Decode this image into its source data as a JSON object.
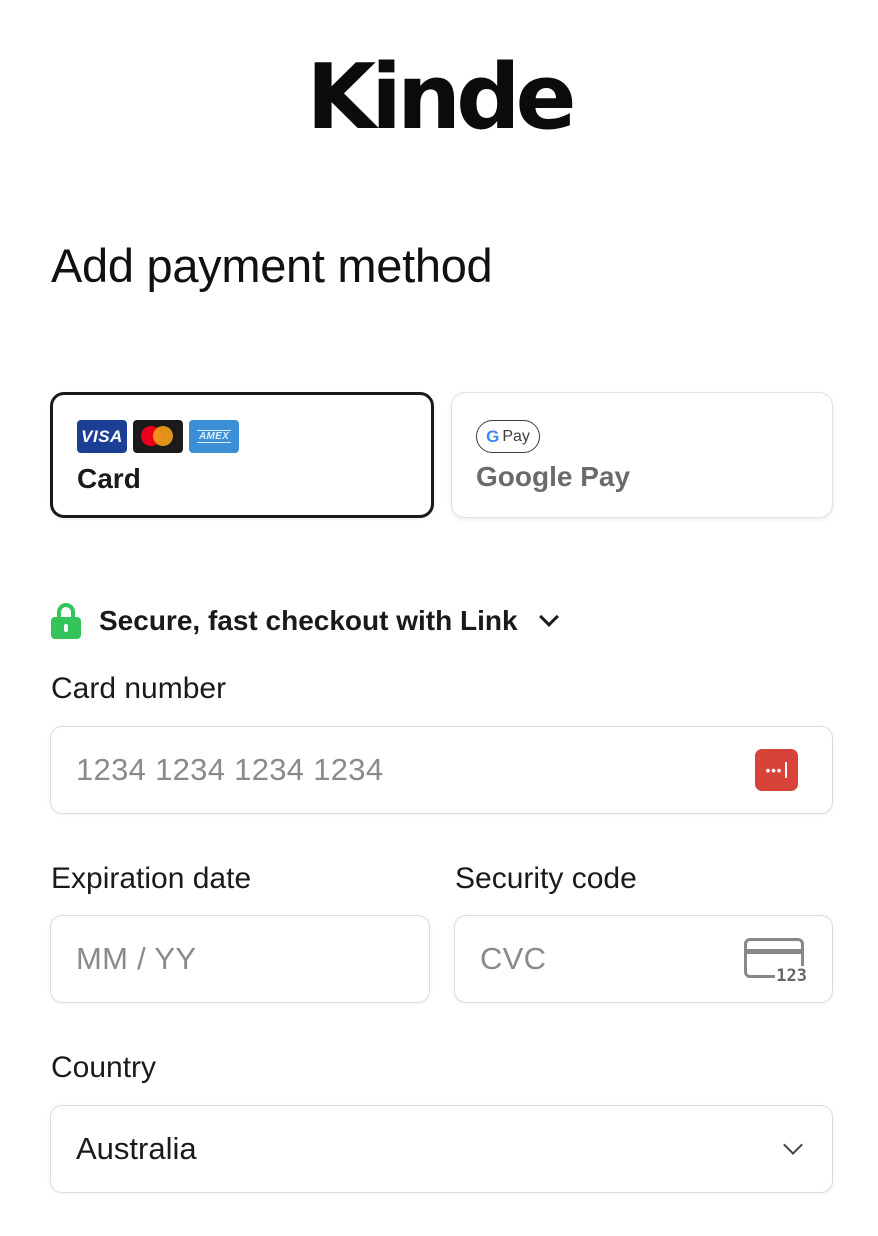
{
  "logo": {
    "text": "Kinde"
  },
  "heading": "Add payment method",
  "methods": {
    "card": {
      "label": "Card",
      "brands": [
        "VISA",
        "mastercard",
        "AMEX"
      ]
    },
    "google_pay": {
      "label": "Google Pay",
      "badge": "Pay",
      "badge_g": "G"
    }
  },
  "link": {
    "text": "Secure, fast checkout with Link",
    "icon": "lock-icon",
    "accent": "#33c55a"
  },
  "card_number": {
    "label": "Card number",
    "placeholder": "1234 1234 1234 1234",
    "value": "",
    "icon": "password-manager-icon",
    "icon_text": "•••"
  },
  "expiration": {
    "label": "Expiration date",
    "placeholder": "MM / YY",
    "value": ""
  },
  "security_code": {
    "label": "Security code",
    "placeholder": "CVC",
    "value": "",
    "icon": "cvc-card-icon",
    "icon_text": "123"
  },
  "country": {
    "label": "Country",
    "value": "Australia"
  }
}
